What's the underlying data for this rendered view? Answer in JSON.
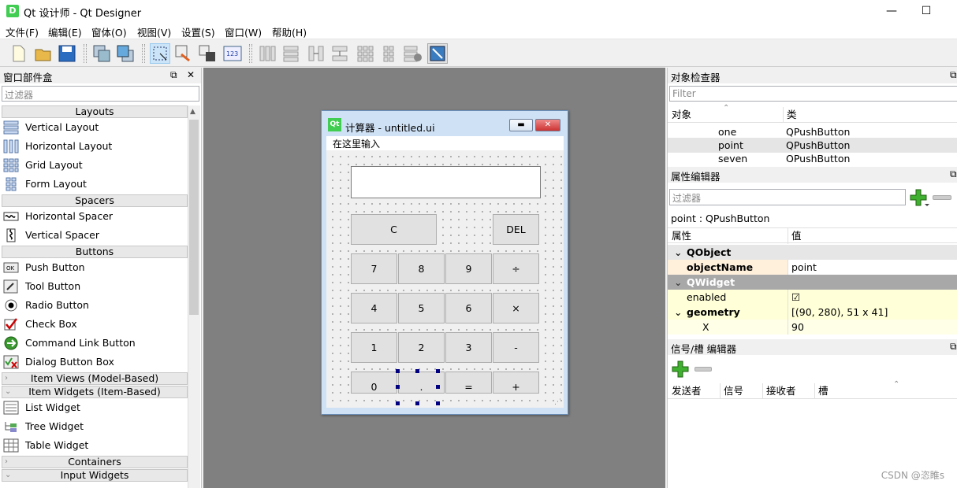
{
  "window": {
    "title": "Qt 设计师 - Qt Designer",
    "icon": "D",
    "min": "—",
    "max": "☐",
    "close": "✕"
  },
  "menubar": [
    "文件(F)",
    "编辑(E)",
    "窗体(O)",
    "视图(V)",
    "设置(S)",
    "窗口(W)",
    "帮助(H)"
  ],
  "toolbar": [
    "new-icon",
    "open-icon",
    "save-icon",
    "send-to-back-icon",
    "bring-to-front-icon",
    "edit-widgets-icon",
    "edit-signals-icon",
    "edit-buddies-icon",
    "edit-tab-order-icon",
    "layout-horizontal-icon",
    "layout-vertical-icon",
    "splitter-horizontal-icon",
    "splitter-vertical-icon",
    "layout-grid-icon",
    "layout-form-icon",
    "break-layout-icon",
    "adjust-size-icon"
  ],
  "widget_box": {
    "title": "窗口部件盒",
    "filter_placeholder": "过滤器",
    "categories": [
      {
        "name": "Layouts",
        "items": [
          "Vertical Layout",
          "Horizontal Layout",
          "Grid Layout",
          "Form Layout"
        ]
      },
      {
        "name": "Spacers",
        "items": [
          "Horizontal Spacer",
          "Vertical Spacer"
        ]
      },
      {
        "name": "Buttons",
        "items": [
          "Push Button",
          "Tool Button",
          "Radio Button",
          "Check Box",
          "Command Link Button",
          "Dialog Button Box"
        ]
      },
      {
        "name": "Item Views (Model-Based)",
        "items": []
      },
      {
        "name": "Item Widgets (Item-Based)",
        "items": [
          "List Widget",
          "Tree Widget",
          "Table Widget"
        ]
      },
      {
        "name": "Containers",
        "items": []
      },
      {
        "name": "Input Widgets",
        "items": []
      }
    ]
  },
  "form": {
    "title": "计算器 - untitled.ui",
    "qt_icon": "Qt",
    "menu_placeholder": "在这里输入",
    "keys": [
      [
        "C",
        "DEL"
      ],
      [
        "7",
        "8",
        "9",
        "÷"
      ],
      [
        "4",
        "5",
        "6",
        "×"
      ],
      [
        "1",
        "2",
        "3",
        "-"
      ],
      [
        "0",
        ".",
        "=",
        "+"
      ]
    ]
  },
  "object_inspector": {
    "title": "对象检查器",
    "filter_placeholder": "Filter",
    "col_object": "对象",
    "col_class": "类",
    "rows": [
      {
        "object": "one",
        "class": "QPushButton"
      },
      {
        "object": "point",
        "class": "QPushButton"
      },
      {
        "object": "seven",
        "class": "QPushButton"
      }
    ]
  },
  "property_editor": {
    "title": "属性编辑器",
    "filter_placeholder": "过滤器",
    "context": "point : QPushButton",
    "col_property": "属性",
    "col_value": "值",
    "rows": [
      {
        "name": "QObject",
        "value": ""
      },
      {
        "name": "objectName",
        "value": "point"
      },
      {
        "name": "QWidget",
        "value": ""
      },
      {
        "name": "enabled",
        "value": "☑"
      },
      {
        "name": "geometry",
        "value": "[(90, 280), 51 x 41]"
      },
      {
        "name": "X",
        "value": "90"
      }
    ]
  },
  "signal_slot_editor": {
    "title": "信号/槽 编辑器",
    "cols": [
      "发送者",
      "信号",
      "接收者",
      "槽"
    ]
  },
  "watermark": "CSDN @恣睢s",
  "colors": {
    "accent": "#41cd52",
    "selection_handle": "#000080",
    "property_highlight": "#ffffe1",
    "objectname_bg": "#fff0dc"
  }
}
